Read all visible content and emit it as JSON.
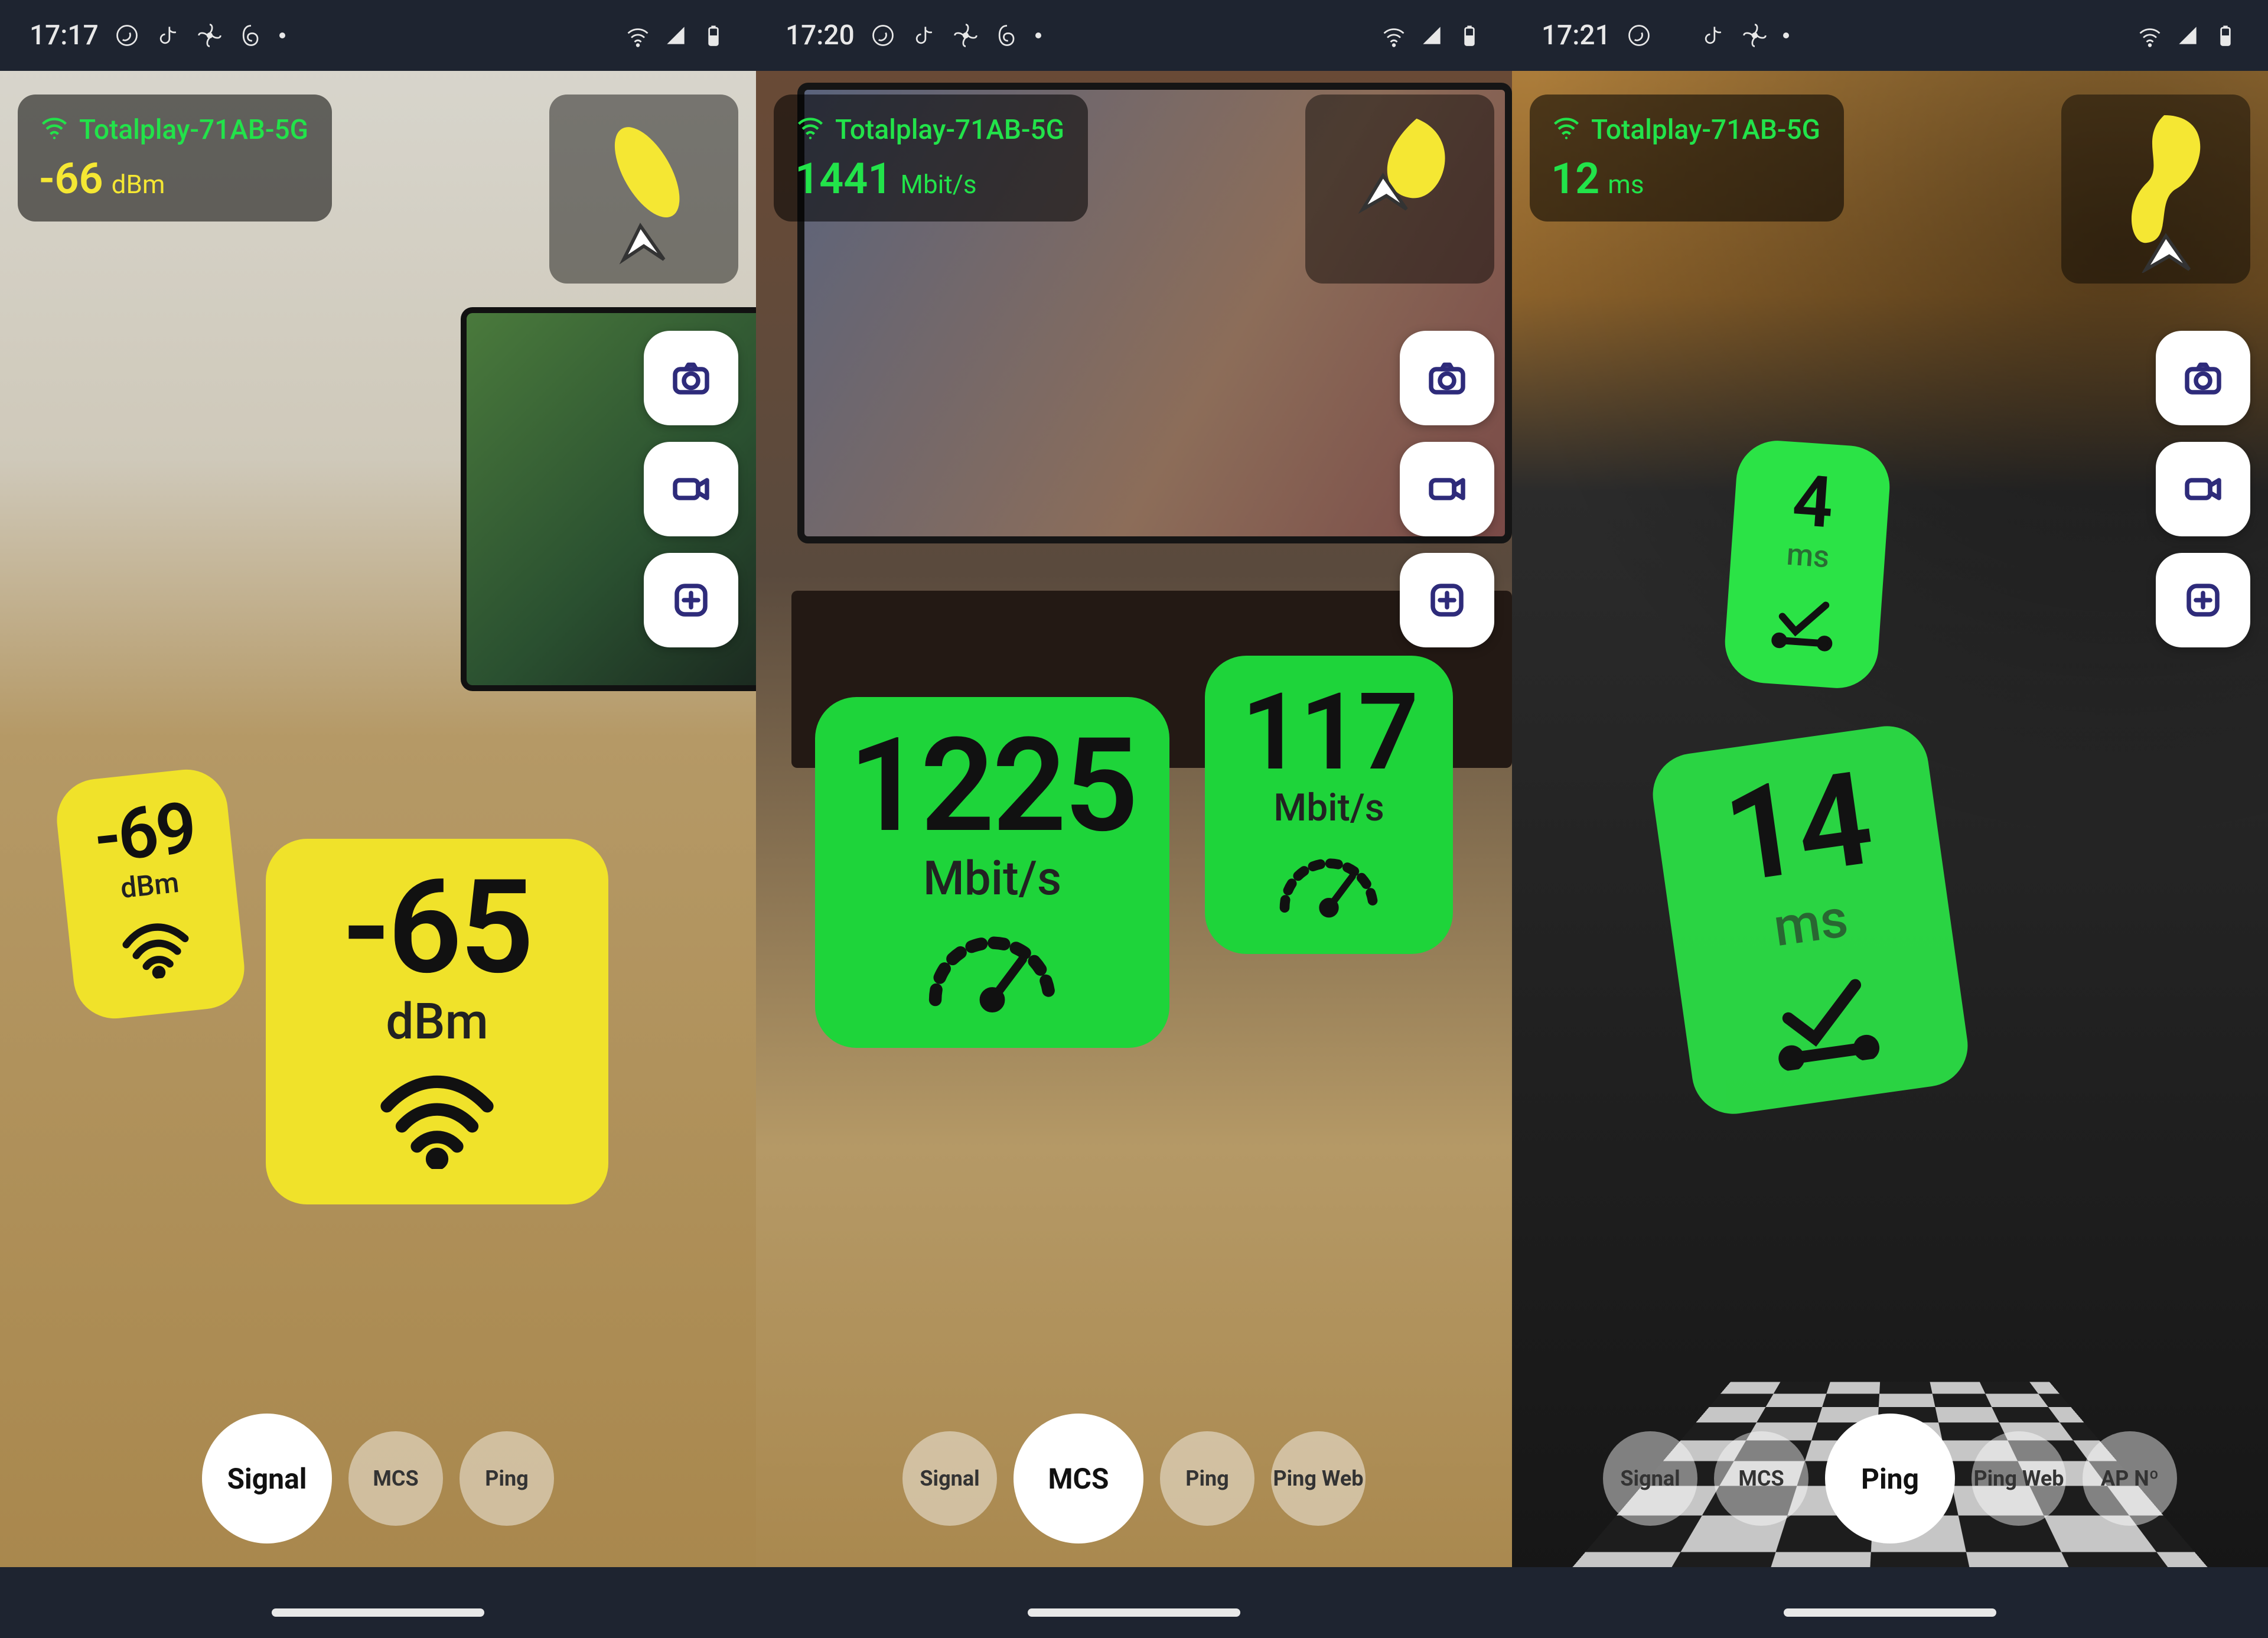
{
  "phones": [
    {
      "time": "17:17",
      "ssid": "Totalplay-71AB-5G",
      "metric_value": "-66",
      "metric_unit": "dBm",
      "metric_color": "yellow",
      "tabs": [
        {
          "label": "Signal",
          "active": true
        },
        {
          "label": "MCS",
          "active": false
        },
        {
          "label": "Ping",
          "active": false
        }
      ],
      "bubbles": [
        {
          "value": "-69",
          "unit": "dBm"
        },
        {
          "value": "-65",
          "unit": "dBm"
        }
      ]
    },
    {
      "time": "17:20",
      "ssid": "Totalplay-71AB-5G",
      "metric_value": "1441",
      "metric_unit": "Mbit/s",
      "metric_color": "green",
      "tabs": [
        {
          "label": "Signal",
          "active": false
        },
        {
          "label": "MCS",
          "active": true
        },
        {
          "label": "Ping",
          "active": false
        },
        {
          "label": "Ping Web",
          "active": false
        }
      ],
      "bubbles": [
        {
          "value": "1225",
          "unit": "Mbit/s"
        },
        {
          "value": "117",
          "unit": "Mbit/s"
        }
      ]
    },
    {
      "time": "17:21",
      "ssid": "Totalplay-71AB-5G",
      "metric_value": "12",
      "metric_unit": "ms",
      "metric_color": "green",
      "tabs": [
        {
          "label": "Signal",
          "active": false
        },
        {
          "label": "MCS",
          "active": false
        },
        {
          "label": "Ping",
          "active": true
        },
        {
          "label": "Ping Web",
          "active": false
        },
        {
          "label": "AP Nº",
          "active": false
        }
      ],
      "bubbles": [
        {
          "value": "4",
          "unit": "ms"
        },
        {
          "value": "14",
          "unit": "ms"
        }
      ]
    }
  ]
}
